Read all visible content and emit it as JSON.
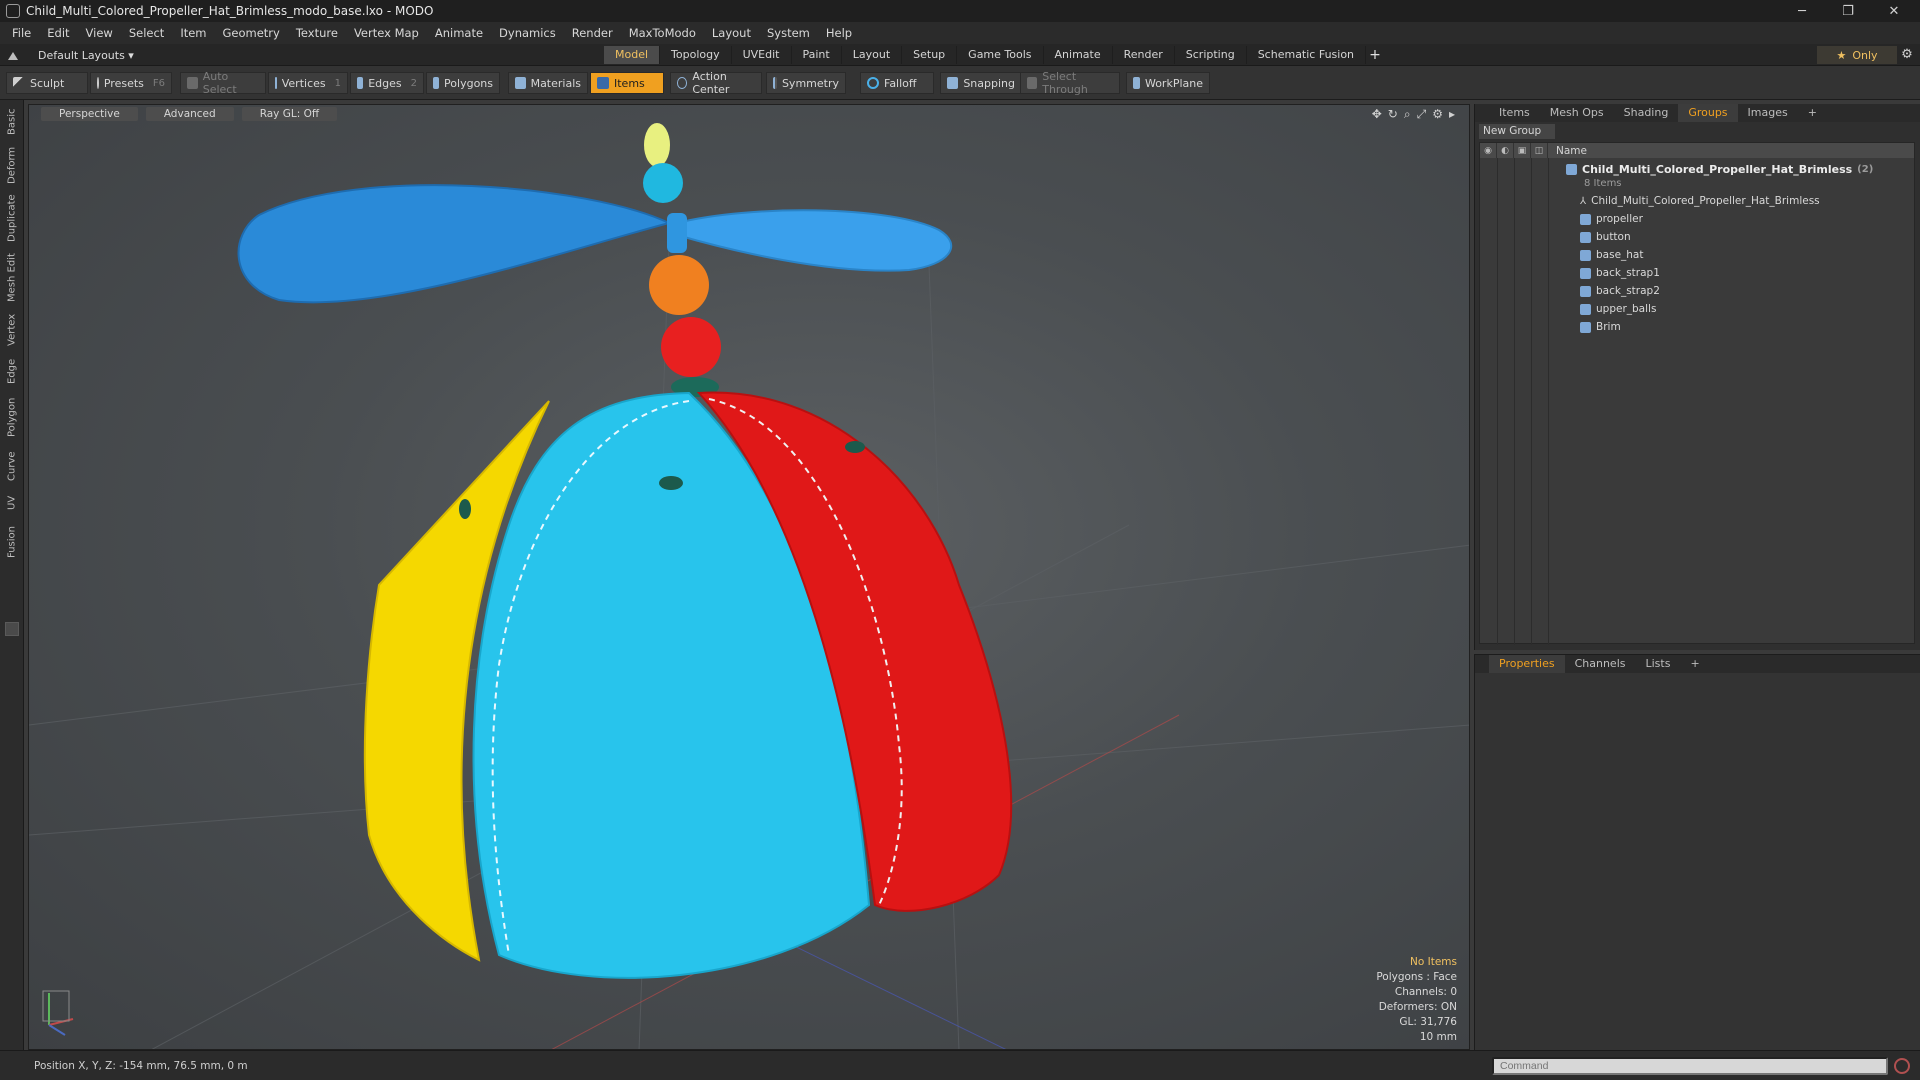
{
  "window": {
    "title": "Child_Multi_Colored_Propeller_Hat_Brimless_modo_base.lxo - MODO",
    "minimize": "─",
    "restore": "❐",
    "close": "✕"
  },
  "menu": [
    "File",
    "Edit",
    "View",
    "Select",
    "Item",
    "Geometry",
    "Texture",
    "Vertex Map",
    "Animate",
    "Dynamics",
    "Render",
    "MaxToModo",
    "Layout",
    "System",
    "Help"
  ],
  "layout": {
    "selector": "Default Layouts ▾",
    "tabs": [
      "Model",
      "Topology",
      "UVEdit",
      "Paint",
      "Layout",
      "Setup",
      "Game Tools",
      "Animate",
      "Render",
      "Scripting",
      "Schematic Fusion"
    ],
    "active_tab": "Model",
    "add": "+",
    "only_label": "Only",
    "star": "★",
    "gear": "⚙"
  },
  "toolbar": {
    "sculpt": "Sculpt",
    "presets": "Presets",
    "presets_key": "F6",
    "auto_select": "Auto Select",
    "vertices": "Vertices",
    "vertices_key": "1",
    "edges": "Edges",
    "edges_key": "2",
    "polygons": "Polygons",
    "materials": "Materials",
    "items": "Items",
    "action_center": "Action Center",
    "symmetry": "Symmetry",
    "falloff": "Falloff",
    "snapping": "Snapping",
    "select_through": "Select Through",
    "workplane": "WorkPlane"
  },
  "vtabs": [
    "Basic",
    "Deform",
    "Duplicate",
    "Mesh Edit",
    "Vertex",
    "Edge",
    "Polygon",
    "Curve",
    "UV",
    "Fusion"
  ],
  "viewport": {
    "perspective": "Perspective",
    "advanced": "Advanced",
    "raygl": "Ray GL: Off",
    "stats": {
      "items": "No Items",
      "polygons": "Polygons : Face",
      "channels": "Channels: 0",
      "deformers": "Deformers: ON",
      "gl": "GL: 31,776",
      "scale": "10 mm"
    }
  },
  "right_panel": {
    "tabs": [
      "Items",
      "Mesh Ops",
      "Shading",
      "Groups",
      "Images"
    ],
    "active_tab": "Groups",
    "add": "+",
    "new_group": "New Group",
    "column_name": "Name",
    "group": {
      "name": "Child_Multi_Colored_Propeller_Hat_Brimless",
      "count": "(2)",
      "subtitle": "8 Items",
      "children": [
        "Child_Multi_Colored_Propeller_Hat_Brimless",
        "propeller",
        "button",
        "base_hat",
        "back_strap1",
        "back_strap2",
        "upper_balls",
        "Brim"
      ]
    }
  },
  "bottom_panel": {
    "tabs": [
      "Properties",
      "Channels",
      "Lists"
    ],
    "active_tab": "Properties",
    "add": "+"
  },
  "status": {
    "position": "Position X, Y, Z:  -154 mm, 76.5 mm, 0 m",
    "command_placeholder": "Command"
  },
  "colors": {
    "accent": "#f0a020",
    "hat_yellow": "#f5d800",
    "hat_cyan": "#28c4ec",
    "hat_red": "#e01818",
    "propeller_blue": "#2a8ad8",
    "ball_orange": "#f08020",
    "ball_red": "#e82020",
    "ball_cyan": "#20b8e0",
    "tip_yellow": "#e8f080"
  }
}
